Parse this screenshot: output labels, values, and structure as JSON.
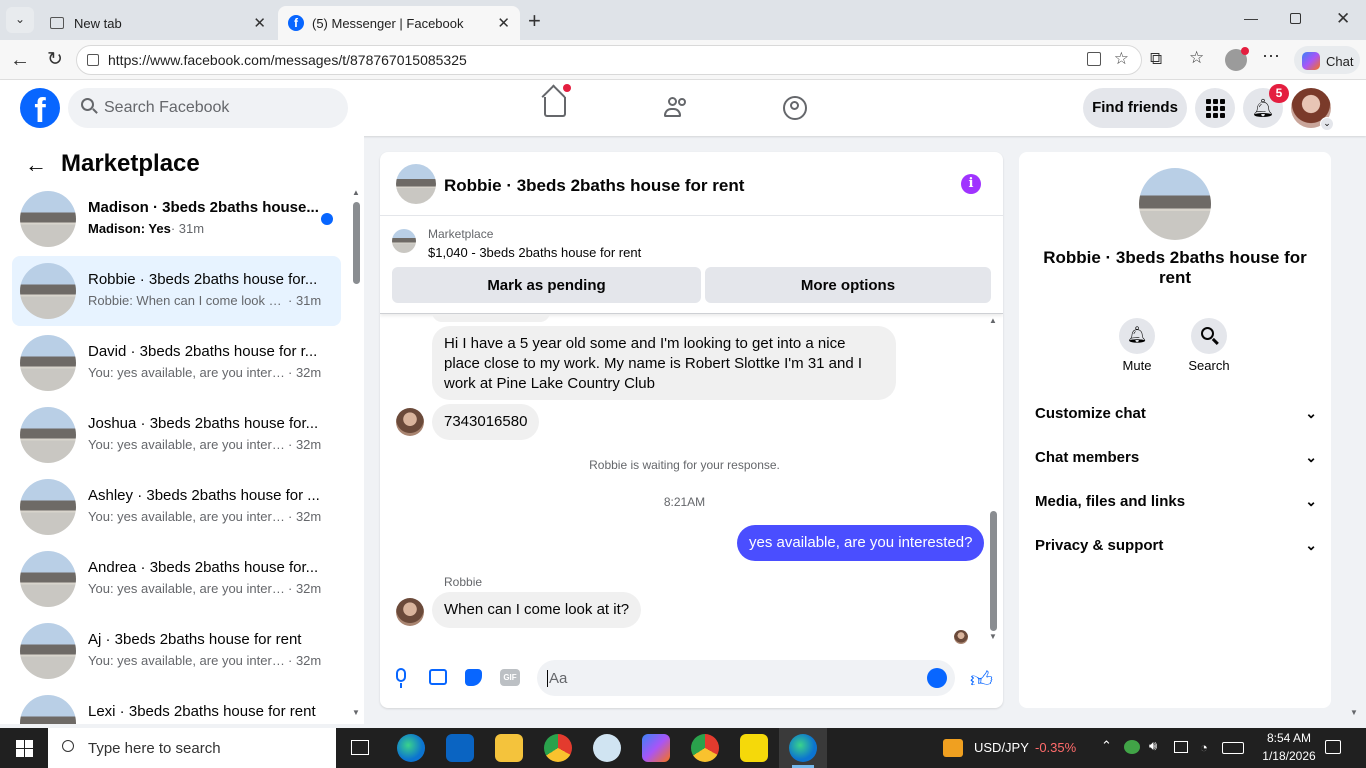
{
  "browser": {
    "tabs": [
      {
        "title": "New tab"
      },
      {
        "title": "(5) Messenger | Facebook"
      }
    ],
    "url": "https://www.facebook.com/messages/t/878767015085325",
    "chat_label": "Chat"
  },
  "fb": {
    "search_placeholder": "Search Facebook",
    "find_friends": "Find friends",
    "notification_count": "5"
  },
  "left": {
    "title": "Marketplace",
    "conversations": [
      {
        "title": "Madison · 3beds 2baths house...",
        "sub_bold": "Madison: Yes",
        "time": "· 31m",
        "unread": true
      },
      {
        "title": "Robbie · 3beds 2baths house for...",
        "sub": "Robbie: When can I come look at...",
        "time": "· 31m",
        "selected": true
      },
      {
        "title": "David · 3beds 2baths house for r...",
        "sub": "You: yes available, are you interes...",
        "time": "· 32m"
      },
      {
        "title": "Joshua · 3beds 2baths house for...",
        "sub": "You: yes available, are you interes...",
        "time": "· 32m"
      },
      {
        "title": "Ashley · 3beds 2baths house for ...",
        "sub": "You: yes available, are you interes...",
        "time": "· 32m"
      },
      {
        "title": "Andrea · 3beds 2baths house for...",
        "sub": "You: yes available, are you interes...",
        "time": "· 32m"
      },
      {
        "title": "Aj · 3beds 2baths house for rent",
        "sub": "You: yes available, are you interes...",
        "time": "· 32m"
      },
      {
        "title": "Lexi · 3beds 2baths house for rent",
        "sub": "",
        "time": ""
      }
    ]
  },
  "chat": {
    "header_title": "Robbie · 3beds 2baths house for rent",
    "listing_source": "Marketplace",
    "listing_desc": "$1,040 - 3beds 2baths house for rent",
    "mark_pending": "Mark as pending",
    "more_options": "More options",
    "messages": {
      "long": "Hi I have a 5 year old some and I'm looking to get into a nice place close to my work. My name is Robert Slottke I'm 31 and I work at Pine Lake Country Club",
      "phone": "7343016580",
      "waiting": "Robbie is waiting for your response.",
      "time": "8:21AM",
      "mine": "yes available, are you interested?",
      "sender": "Robbie",
      "last": "When can I come look at it?"
    },
    "input_placeholder": "Aa"
  },
  "right": {
    "title": "Robbie · 3beds 2baths house for rent",
    "mute": "Mute",
    "search": "Search",
    "sections": [
      "Customize chat",
      "Chat members",
      "Media, files and links",
      "Privacy & support"
    ]
  },
  "taskbar": {
    "search_placeholder": "Type here to search",
    "ticker": "USD/JPY",
    "change": "-0.35%",
    "time": "8:54 AM",
    "date": "1/18/2026"
  },
  "colors": {
    "fb_blue": "#0866ff",
    "messenger_purple": "#a033ff",
    "my_bubble": "#4a4eff",
    "badge_red": "#e41e3f",
    "negative": "#ff6b6b"
  }
}
